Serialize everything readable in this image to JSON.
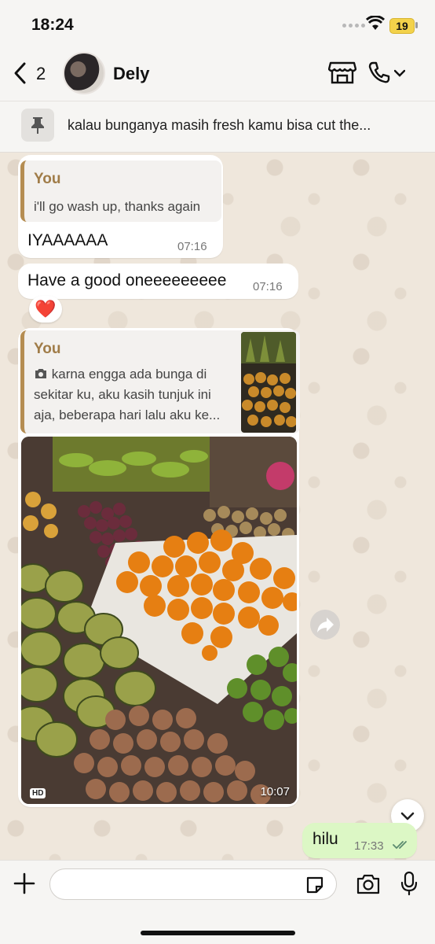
{
  "status_bar": {
    "time": "18:24",
    "battery": "19"
  },
  "header": {
    "back_count": "2",
    "contact_name": "Dely"
  },
  "pinned": {
    "text": "kalau bunganya masih fresh kamu bisa cut the..."
  },
  "messages": [
    {
      "quote_author": "You",
      "quote_text": "i'll go wash up, thanks again",
      "text": "IYAAAAAA",
      "time": "07:16"
    },
    {
      "text": "Have a good oneeeeeeeee",
      "time": "07:16",
      "reaction": "❤️"
    },
    {
      "quote_author": "You",
      "quote_line1": "karna engga ada bunga di",
      "quote_line2": "sekitar ku, aku kasih tunjuk ini",
      "quote_line3": "aja, beberapa hari lalu aku ke...",
      "hd": "HD",
      "time": "10:07"
    },
    {
      "text": "hilu",
      "time": "17:33"
    }
  ],
  "colors": {
    "accent_quote": "#b58d52",
    "outgoing_bubble": "#dcf7c5",
    "read_ticks": "#5b8a6f"
  }
}
